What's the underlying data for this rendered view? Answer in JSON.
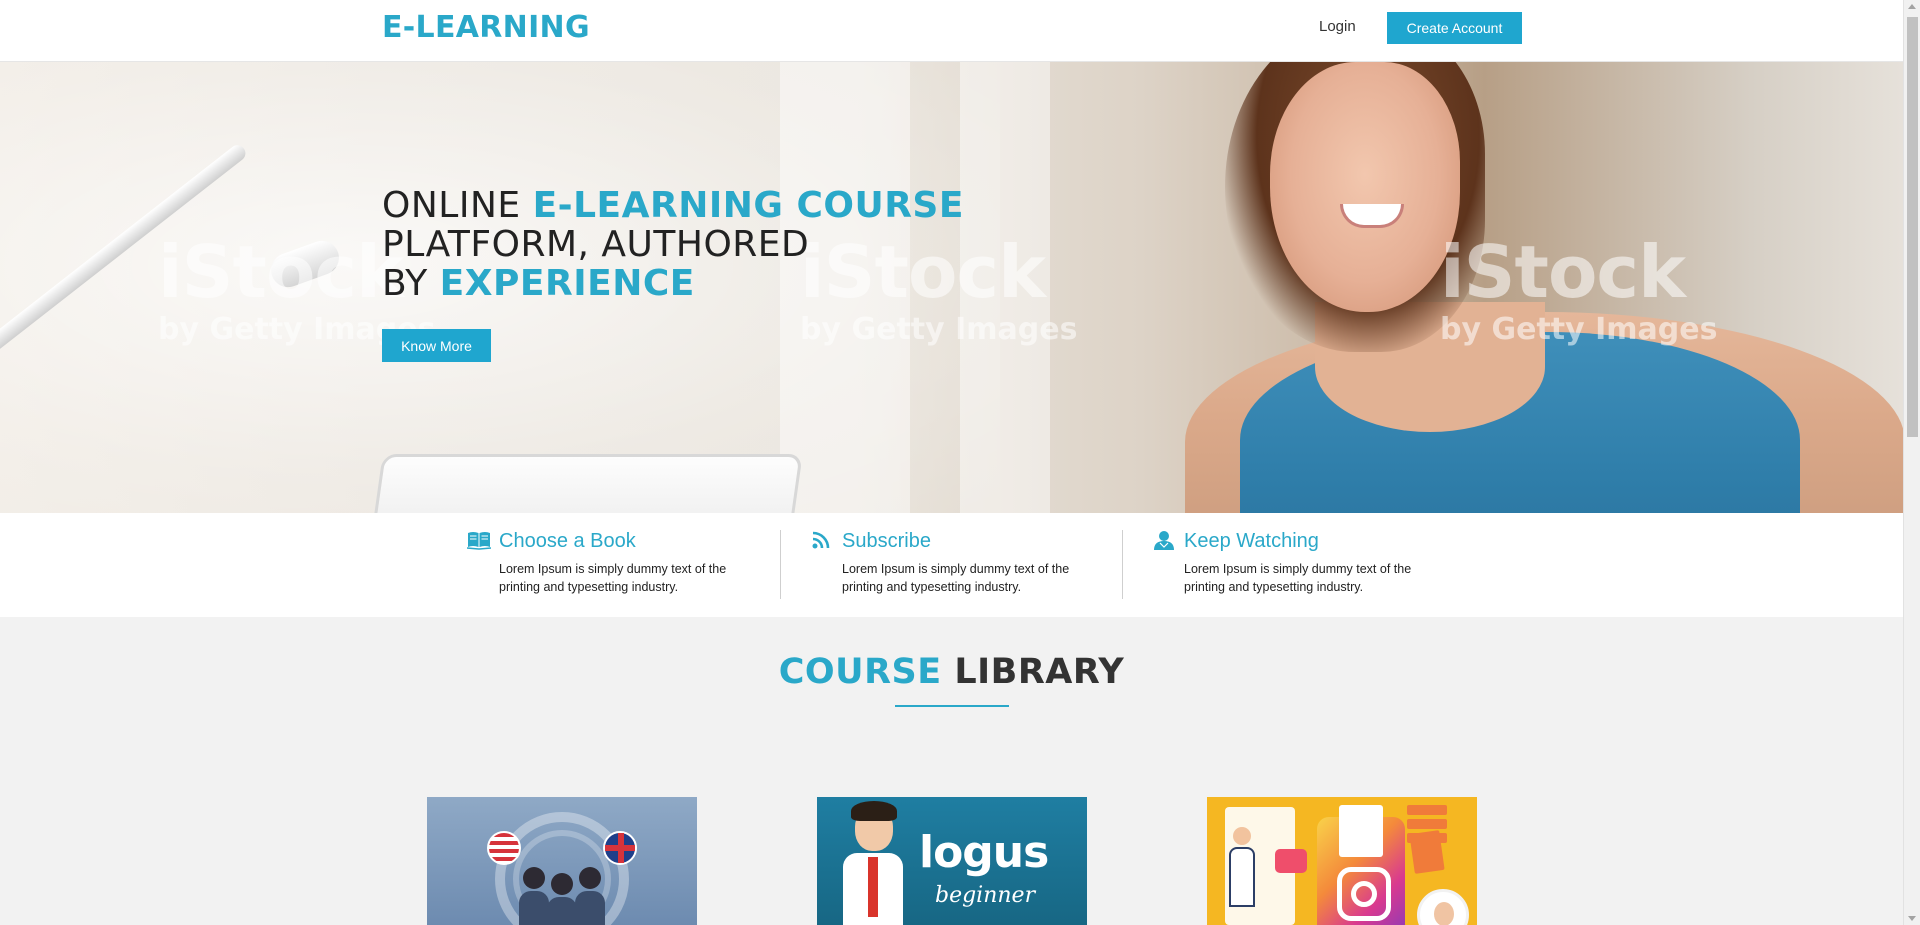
{
  "header": {
    "logo": "E-LEARNING",
    "login_label": "Login",
    "create_account_label": "Create Account"
  },
  "hero": {
    "line1_plain": "ONLINE ",
    "line1_accent": "E-LEARNING COURSE",
    "line2_plain": "PLATFORM, AUTHORED",
    "line3_plain": "BY ",
    "line3_accent": "EXPERIENCE",
    "button_label": "Know More",
    "watermark_main": "iStock",
    "watermark_sub": "by Getty Images"
  },
  "features": [
    {
      "icon": "open-book-icon",
      "title": "Choose a Book",
      "text": "Lorem Ipsum is simply dummy text of the printing and typesetting industry."
    },
    {
      "icon": "rss-icon",
      "title": "Subscribe",
      "text": "Lorem Ipsum is simply dummy text of the printing and typesetting industry."
    },
    {
      "icon": "user-icon",
      "title": "Keep Watching",
      "text": "Lorem Ipsum is simply dummy text of the printing and typesetting industry."
    }
  ],
  "library": {
    "title_accent": "COURSE",
    "title_plain": " LIBRARY"
  },
  "courses": [
    {
      "image": "language-learning-illustration"
    },
    {
      "image": "logus-beginner-illustration",
      "logo_text": "logus",
      "subtitle": "beginner"
    },
    {
      "image": "instagram-marketing-illustration"
    }
  ],
  "colors": {
    "accent": "#2aa8c9",
    "button": "#1fa6cf",
    "text": "#222222",
    "background": "#f2f2f2"
  }
}
